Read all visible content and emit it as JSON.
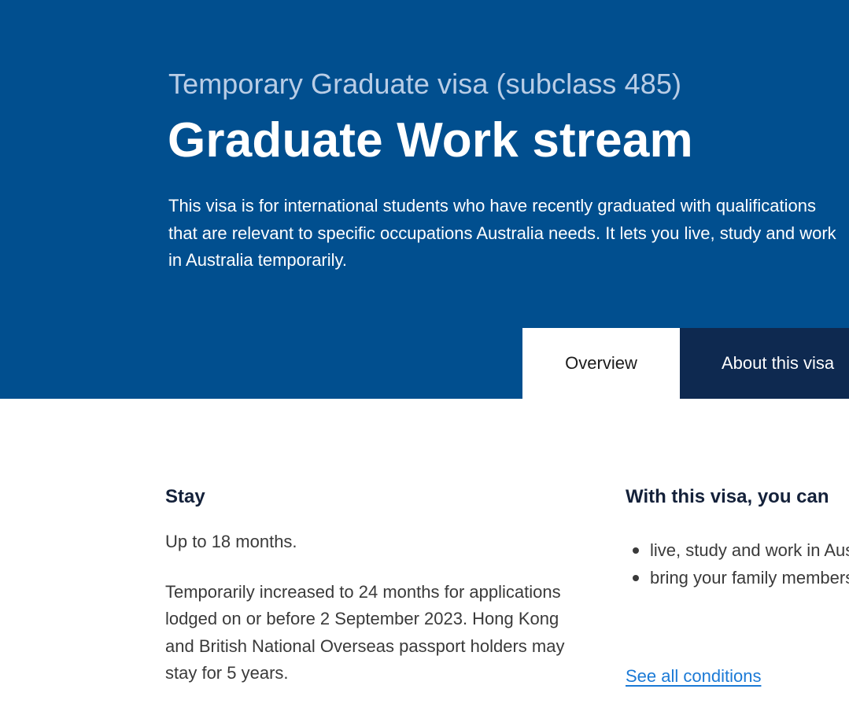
{
  "hero": {
    "subtitle": "Temporary Graduate visa (subclass 485)",
    "title": "Graduate Work stream",
    "description": "This visa is for international students who have recently graduated with qualifications that are relevant to specific occupations Australia needs. It lets you live, study and work in Australia temporarily."
  },
  "tabs": [
    {
      "label": "Overview",
      "active": true
    },
    {
      "label": "About this visa",
      "active": false
    }
  ],
  "stay": {
    "heading": "Stay",
    "duration": "Up to 18 months.",
    "note": "Temporarily increased to 24 months for applications lodged on or before 2 September 2023. Hong Kong and British National Overseas passport holders may stay for 5 years."
  },
  "conditions": {
    "heading": "With this visa, you can",
    "items": [
      "live, study and work in Australia",
      "bring your family members"
    ],
    "link_label": "See all conditions"
  },
  "colors": {
    "hero_bg": "#014f8f",
    "tab_dark": "#0e2950",
    "link": "#1b7ad6"
  }
}
